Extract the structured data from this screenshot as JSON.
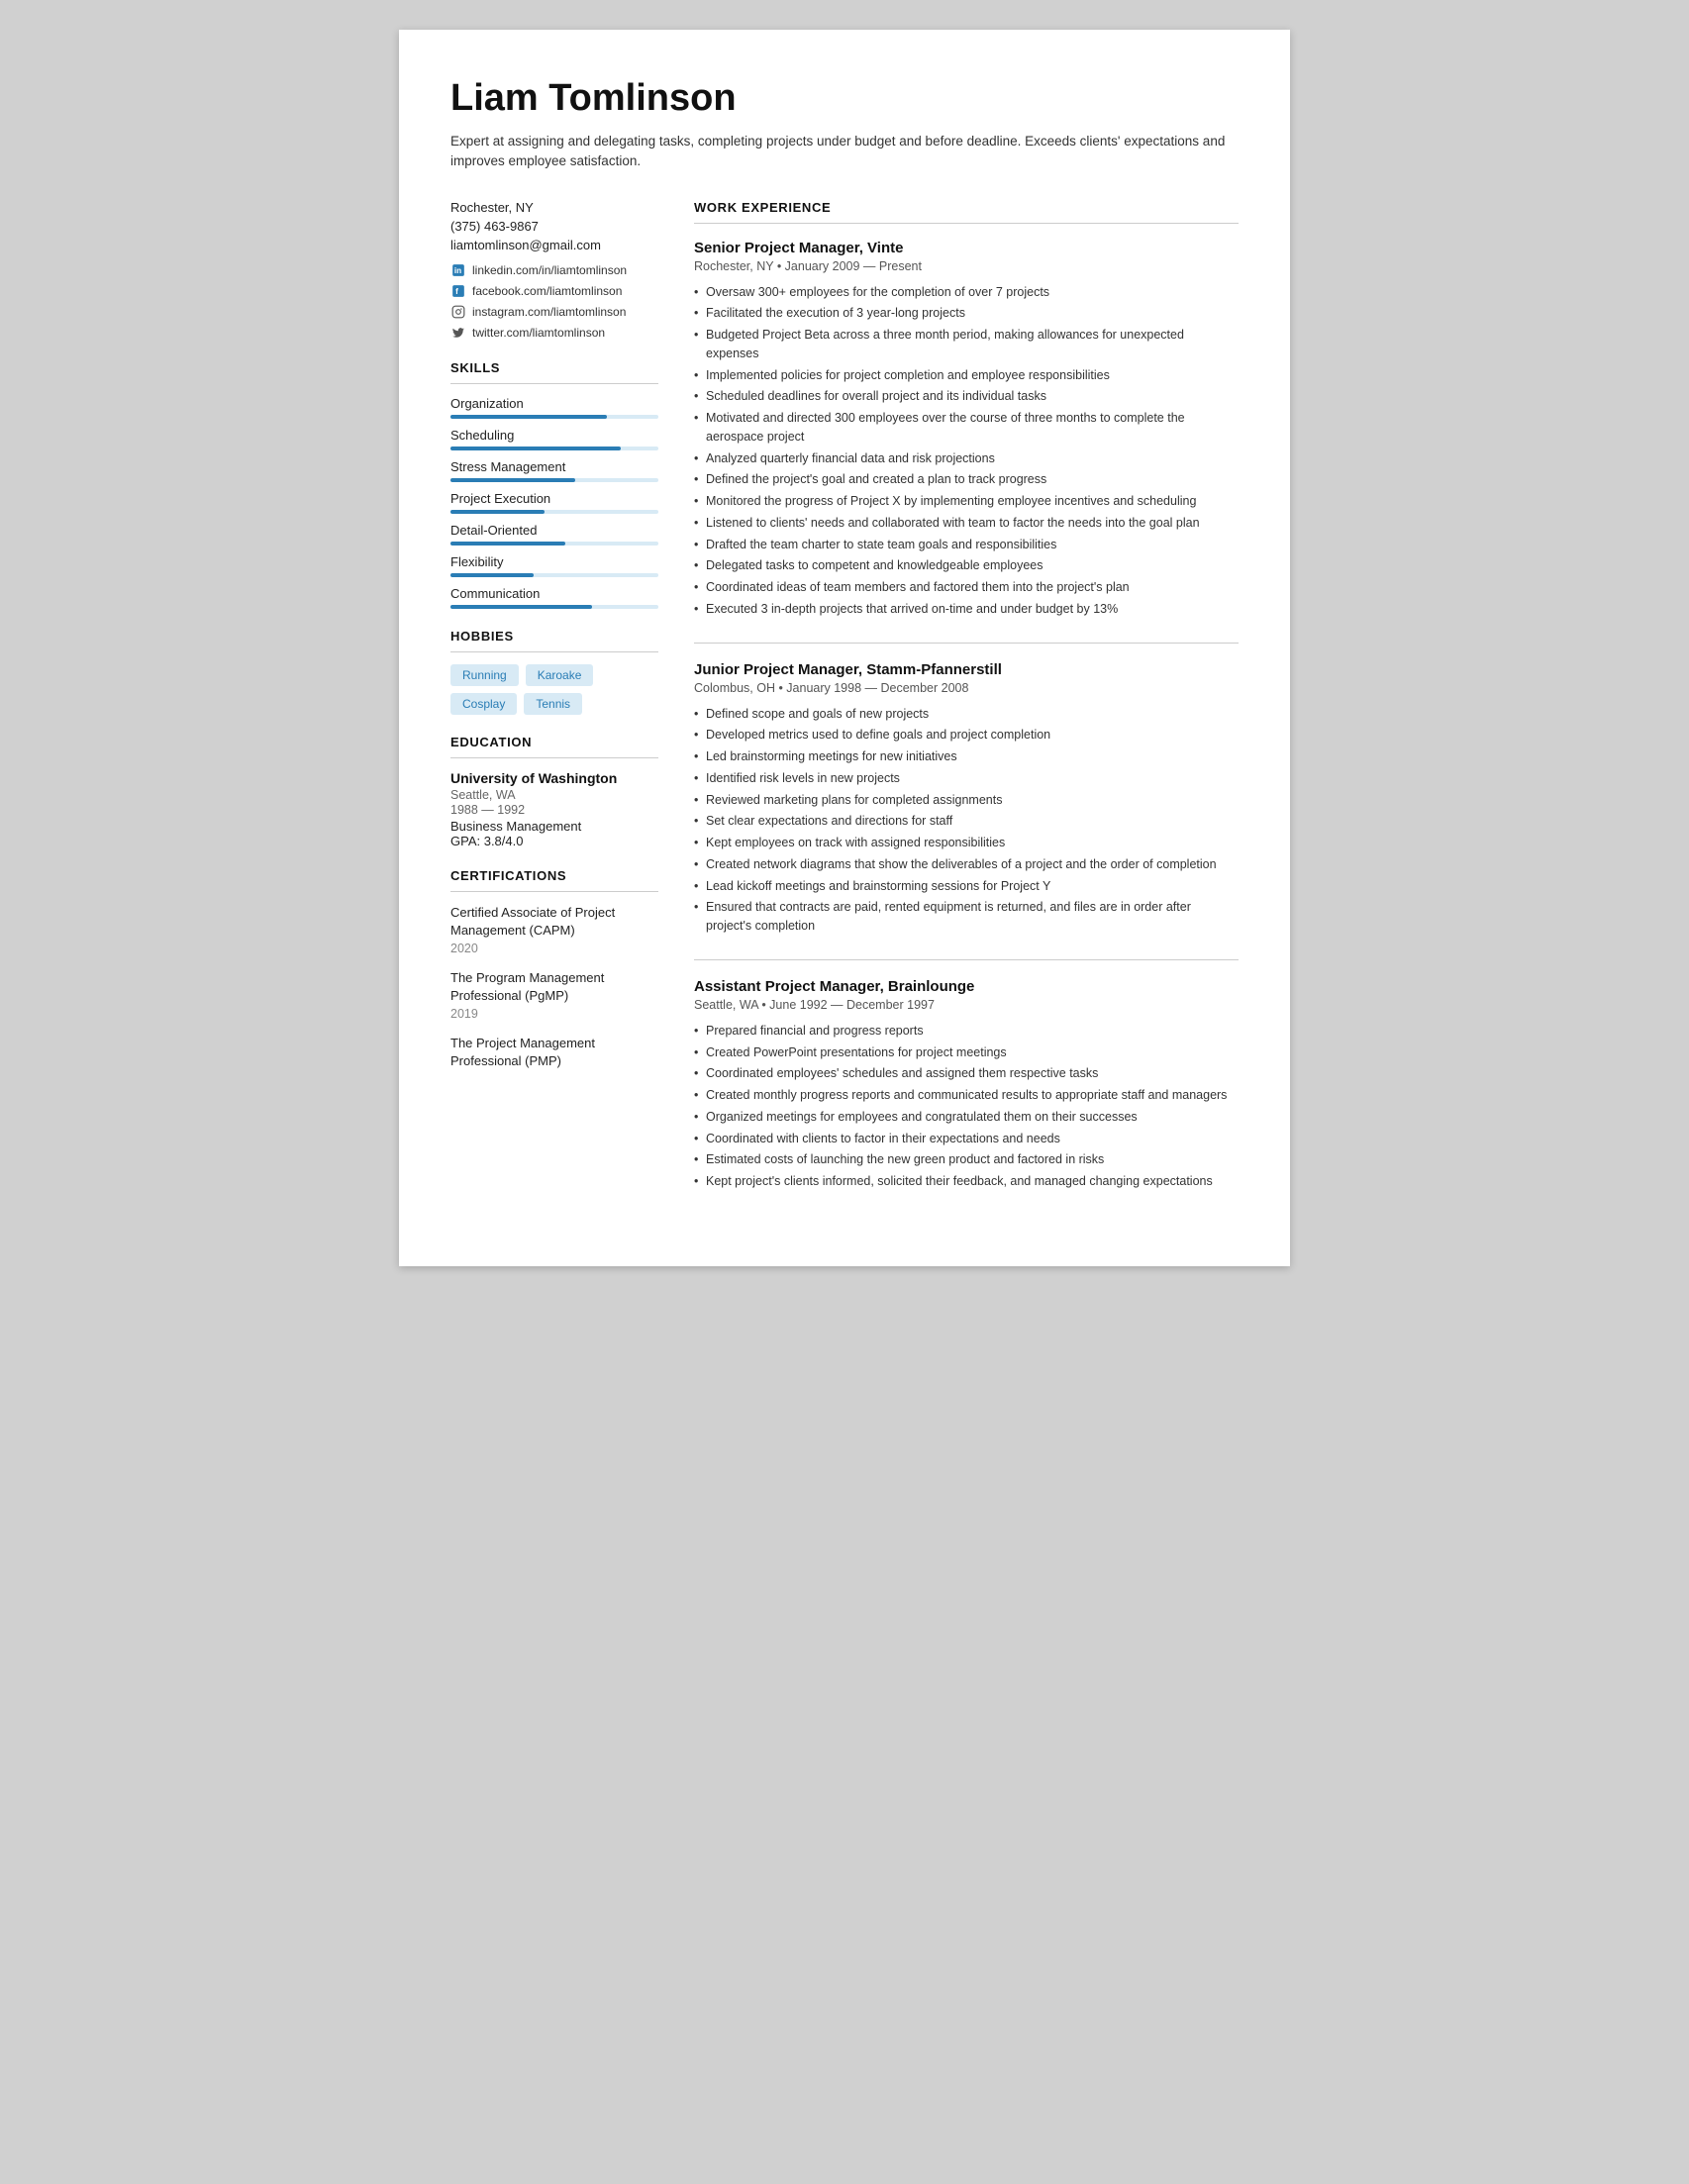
{
  "header": {
    "name": "Liam Tomlinson",
    "summary": "Expert at assigning and delegating tasks, completing projects under budget and before deadline. Exceeds clients' expectations and improves employee satisfaction."
  },
  "contact": {
    "location": "Rochester, NY",
    "phone": "(375) 463-9867",
    "email": "liamtomlinson@gmail.com",
    "social": [
      {
        "icon": "linkedin",
        "label": "linkedin.com/in/liamtomlinson"
      },
      {
        "icon": "facebook",
        "label": "facebook.com/liamtomlinson"
      },
      {
        "icon": "instagram",
        "label": "instagram.com/liamtomlinson"
      },
      {
        "icon": "twitter",
        "label": "twitter.com/liamtomlinson"
      }
    ]
  },
  "skills": {
    "title": "SKILLS",
    "items": [
      {
        "name": "Organization",
        "pct": 75
      },
      {
        "name": "Scheduling",
        "pct": 82
      },
      {
        "name": "Stress Management",
        "pct": 60
      },
      {
        "name": "Project Execution",
        "pct": 45
      },
      {
        "name": "Detail-Oriented",
        "pct": 55
      },
      {
        "name": "Flexibility",
        "pct": 40
      },
      {
        "name": "Communication",
        "pct": 68
      }
    ]
  },
  "hobbies": {
    "title": "HOBBIES",
    "items": [
      "Running",
      "Karoake",
      "Cosplay",
      "Tennis"
    ]
  },
  "education": {
    "title": "EDUCATION",
    "school": "University of Washington",
    "location": "Seattle, WA",
    "years": "1988 — 1992",
    "field": "Business Management",
    "gpa": "GPA: 3.8/4.0"
  },
  "certifications": {
    "title": "CERTIFICATIONS",
    "items": [
      {
        "name": "Certified Associate of Project Management (CAPM)",
        "year": "2020"
      },
      {
        "name": "The Program Management Professional (PgMP)",
        "year": "2019"
      },
      {
        "name": "The Project Management Professional (PMP)",
        "year": ""
      }
    ]
  },
  "work": {
    "section_title": "WORK EXPERIENCE",
    "jobs": [
      {
        "title": "Senior Project Manager, Vinte",
        "meta": "Rochester, NY • January 2009 — Present",
        "bullets": [
          "Oversaw 300+ employees for the completion of over 7 projects",
          "Facilitated the execution of 3 year-long projects",
          "Budgeted Project Beta across a three month period, making allowances for unexpected expenses",
          "Implemented policies for project completion and employee responsibilities",
          "Scheduled deadlines for overall project and its individual tasks",
          "Motivated and directed 300 employees over the course of three months to complete the aerospace project",
          "Analyzed quarterly financial data and risk projections",
          "Defined the project's goal and created a plan to track progress",
          "Monitored the progress of Project X by implementing employee incentives and scheduling",
          "Listened to clients' needs and collaborated with team to factor the needs into the goal plan",
          "Drafted the team charter to state team goals and responsibilities",
          "Delegated tasks to competent and knowledgeable employees",
          "Coordinated ideas of team members and factored them into the project's plan",
          "Executed 3 in-depth projects that arrived on-time and under budget by 13%"
        ]
      },
      {
        "title": "Junior Project Manager, Stamm-Pfannerstill",
        "meta": "Colombus, OH • January 1998 — December 2008",
        "bullets": [
          "Defined scope and goals of new projects",
          "Developed metrics used to define goals and project completion",
          "Led brainstorming meetings for new initiatives",
          "Identified risk levels in new projects",
          "Reviewed marketing plans for completed assignments",
          "Set clear expectations and directions for staff",
          "Kept employees on track with assigned responsibilities",
          "Created network diagrams that show the deliverables of a project and the order of completion",
          "Lead kickoff meetings and brainstorming sessions for Project Y",
          "Ensured that contracts are paid, rented equipment is returned, and files are in order after project's completion"
        ]
      },
      {
        "title": "Assistant Project Manager, Brainlounge",
        "meta": "Seattle, WA • June 1992 — December 1997",
        "bullets": [
          "Prepared financial and progress reports",
          "Created PowerPoint presentations for project meetings",
          "Coordinated employees' schedules and assigned them respective tasks",
          "Created monthly progress reports and communicated results to appropriate staff and managers",
          "Organized meetings for employees and congratulated them on their successes",
          "Coordinated with clients to factor in their expectations and needs",
          "Estimated costs of launching the new green product and factored in risks",
          "Kept project's clients informed, solicited their feedback, and managed changing expectations"
        ]
      }
    ]
  }
}
